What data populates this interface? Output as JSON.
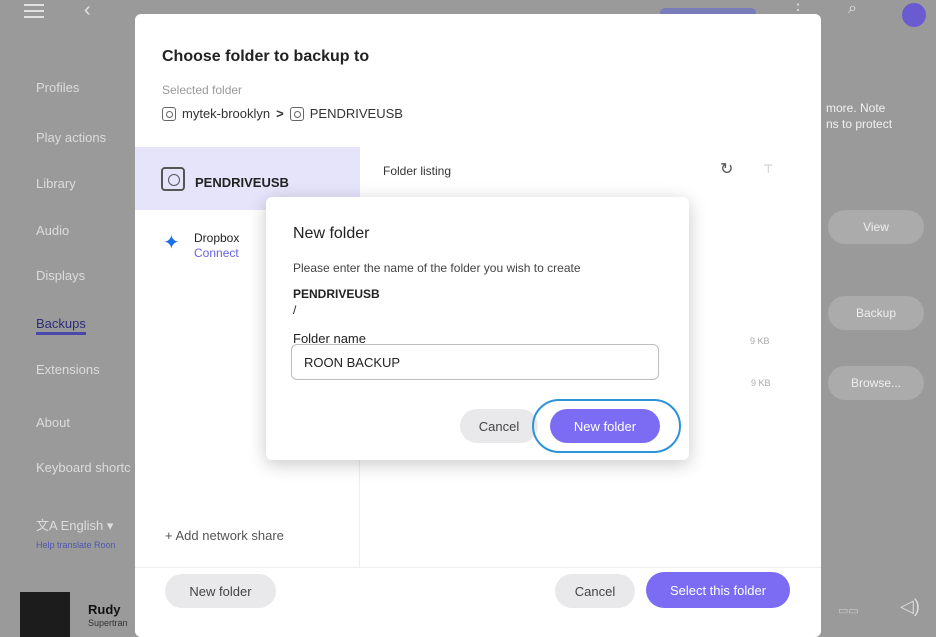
{
  "background": {
    "nav_items": [
      "Profiles",
      "Play actions",
      "Library",
      "Audio",
      "Displays",
      "Backups",
      "Extensions",
      "About",
      "Keyboard shortc"
    ],
    "active_nav": "Backups",
    "language": "English",
    "language_link": "Help translate Roon",
    "right_text": [
      "more. Note",
      "ns to protect"
    ],
    "right_buttons": [
      "View",
      "Backup",
      "Browse..."
    ],
    "player": {
      "track": "Rudy",
      "artist": "Supertran"
    }
  },
  "dialog": {
    "title": "Choose folder to backup to",
    "selected_label": "Selected folder",
    "path_host": "mytek-brooklyn",
    "path_chevron": ">",
    "path_folder": "PENDRIVEUSB",
    "sources": {
      "active": "PENDRIVEUSB",
      "dropbox_name": "Dropbox",
      "dropbox_link": "Connect"
    },
    "listing_header": "Folder listing",
    "sizes": [
      "9 KB",
      "9 KB"
    ],
    "add_share": "+ Add network share",
    "footer": {
      "new_folder": "New folder",
      "cancel": "Cancel",
      "select": "Select this folder"
    }
  },
  "modal": {
    "title": "New folder",
    "description": "Please enter the name of the folder you wish to create",
    "path_line1": "PENDRIVEUSB",
    "path_line2": "/",
    "field_label": "Folder name",
    "field_value": "ROON BACKUP",
    "cancel": "Cancel",
    "confirm": "New folder"
  },
  "colors": {
    "accent": "#7b6cf3",
    "highlight_ring": "#2b93d8",
    "active_source_bg": "#e6e4fb"
  }
}
